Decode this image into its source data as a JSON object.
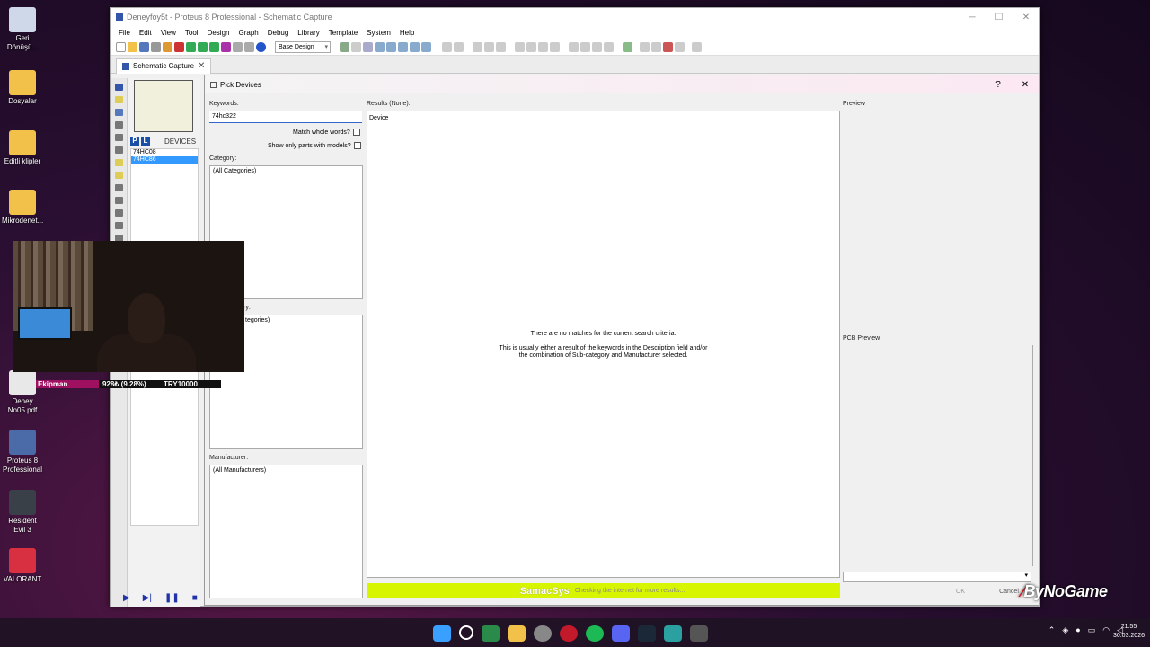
{
  "window": {
    "title": "Deneyfoy5t - Proteus 8 Professional - Schematic Capture",
    "controls": {
      "minimize": "─",
      "maximize": "☐",
      "close": "✕"
    }
  },
  "menu": [
    "File",
    "Edit",
    "View",
    "Tool",
    "Design",
    "Graph",
    "Debug",
    "Library",
    "Template",
    "System",
    "Help"
  ],
  "toolbar": {
    "design_select": "Base Design"
  },
  "tab": {
    "label": "Schematic Capture",
    "close": "✕"
  },
  "devices": {
    "header": "DEVICES",
    "p": "P",
    "l": "L",
    "items": [
      "74HC08",
      "74HC86"
    ],
    "selected_index": 1
  },
  "dialog": {
    "title": "Pick Devices",
    "help": "?",
    "close": "✕",
    "keywords_label": "Keywords:",
    "keywords_value": "74hc322",
    "match_whole_words": "Match whole words?",
    "only_models": "Show only parts with models?",
    "category_label": "Category:",
    "category_value": "(All Categories)",
    "subcategory_label": "ry:",
    "subcategory_value": "tegories)",
    "manufacturer_label": "Manufacturer:",
    "manufacturer_value": "(All Manufacturers)",
    "results_label": "Results (None):",
    "results_col": "Device",
    "no_match_1": "There are no matches for the current search criteria.",
    "no_match_2": "This is usually either a result of the keywords in the Description field and/or",
    "no_match_3": "the combination of Sub-category and Manufacturer selected.",
    "samacsys_brand": "SamacSys",
    "samacsys_status": "Checking the internet for more results....",
    "preview_label": "Preview",
    "pcb_preview_label": "PCB Preview",
    "ok": "OK",
    "cancel": "Cancel"
  },
  "desktop_icons": [
    {
      "label": "Geri Dönüşü...",
      "color": "#cfd8e8"
    },
    {
      "label": "Dosyalar",
      "color": "#f2c14a"
    },
    {
      "label": "Editli klipler",
      "color": "#f2c14a"
    },
    {
      "label": "Mikrodenet...",
      "color": "#f2c14a"
    },
    {
      "label": "Deney No05.pdf",
      "color": "#e8e8e8"
    },
    {
      "label": "Proteus 8 Professional",
      "color": "#4a6aa8"
    },
    {
      "label": "Resident Evil 3",
      "color": "#3a4048"
    },
    {
      "label": "VALORANT",
      "color": "#d83040"
    }
  ],
  "stream": {
    "name": "Ekipman",
    "progress": "928₺ (9.28%)",
    "goal": "TRY10000"
  },
  "brand_logo": "ByNoGame",
  "taskbar": {
    "time": "21:55",
    "date": "30.03.2026"
  }
}
